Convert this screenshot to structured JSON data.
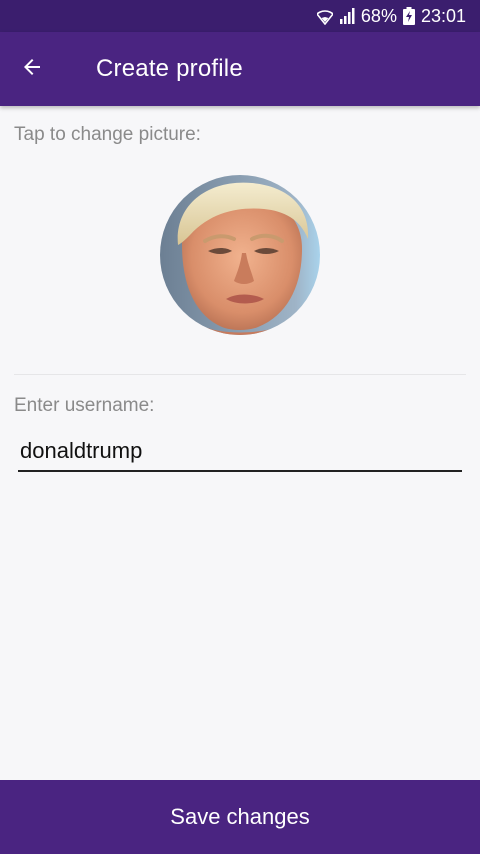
{
  "status_bar": {
    "battery": "68%",
    "time": "23:01",
    "icons": [
      "wifi-icon",
      "signal-icon",
      "battery-charging-icon"
    ]
  },
  "app_bar": {
    "title": "Create profile",
    "back_icon": "arrow-back-icon"
  },
  "profile": {
    "picture_label": "Tap to change picture:",
    "username_label": "Enter username:",
    "username_value": "donaldtrump"
  },
  "footer": {
    "save_label": "Save changes"
  },
  "colors": {
    "primary": "#4a2481",
    "status_bar": "#3b1e6e",
    "background": "#f7f7f9"
  }
}
